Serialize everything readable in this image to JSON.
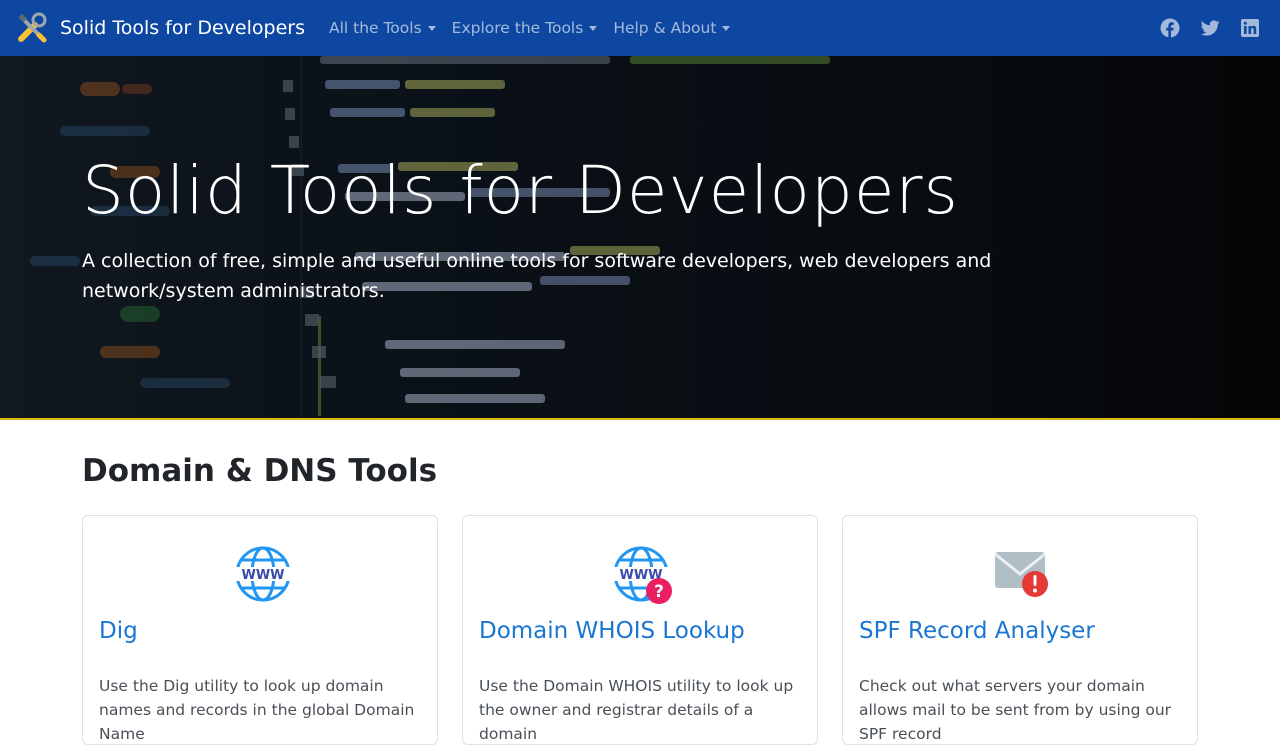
{
  "navbar": {
    "brand": "Solid Tools for Developers",
    "menu": [
      {
        "label": "All the Tools"
      },
      {
        "label": "Explore the Tools"
      },
      {
        "label": "Help & About"
      }
    ],
    "social": [
      "facebook-icon",
      "twitter-icon",
      "linkedin-icon"
    ]
  },
  "hero": {
    "title": "Solid Tools for Developers",
    "lead": "A collection of free, simple and useful online tools for software developers, web developers and network/system administrators."
  },
  "section": {
    "title": "Domain & DNS Tools",
    "cards": [
      {
        "icon": "www-globe-icon",
        "title": "Dig",
        "text": "Use the Dig utility to look up domain names and records in the global Domain Name"
      },
      {
        "icon": "www-question-icon",
        "title": "Domain WHOIS Lookup",
        "text": "Use the Domain WHOIS utility to look up the owner and registrar details of a domain"
      },
      {
        "icon": "mail-alert-icon",
        "title": "SPF Record Analyser",
        "text": "Check out what servers your domain allows mail to be sent from by using our SPF record"
      }
    ]
  },
  "colors": {
    "navbar": "#0d47a1",
    "link": "#1976d2",
    "accent": "#e0b90f"
  }
}
